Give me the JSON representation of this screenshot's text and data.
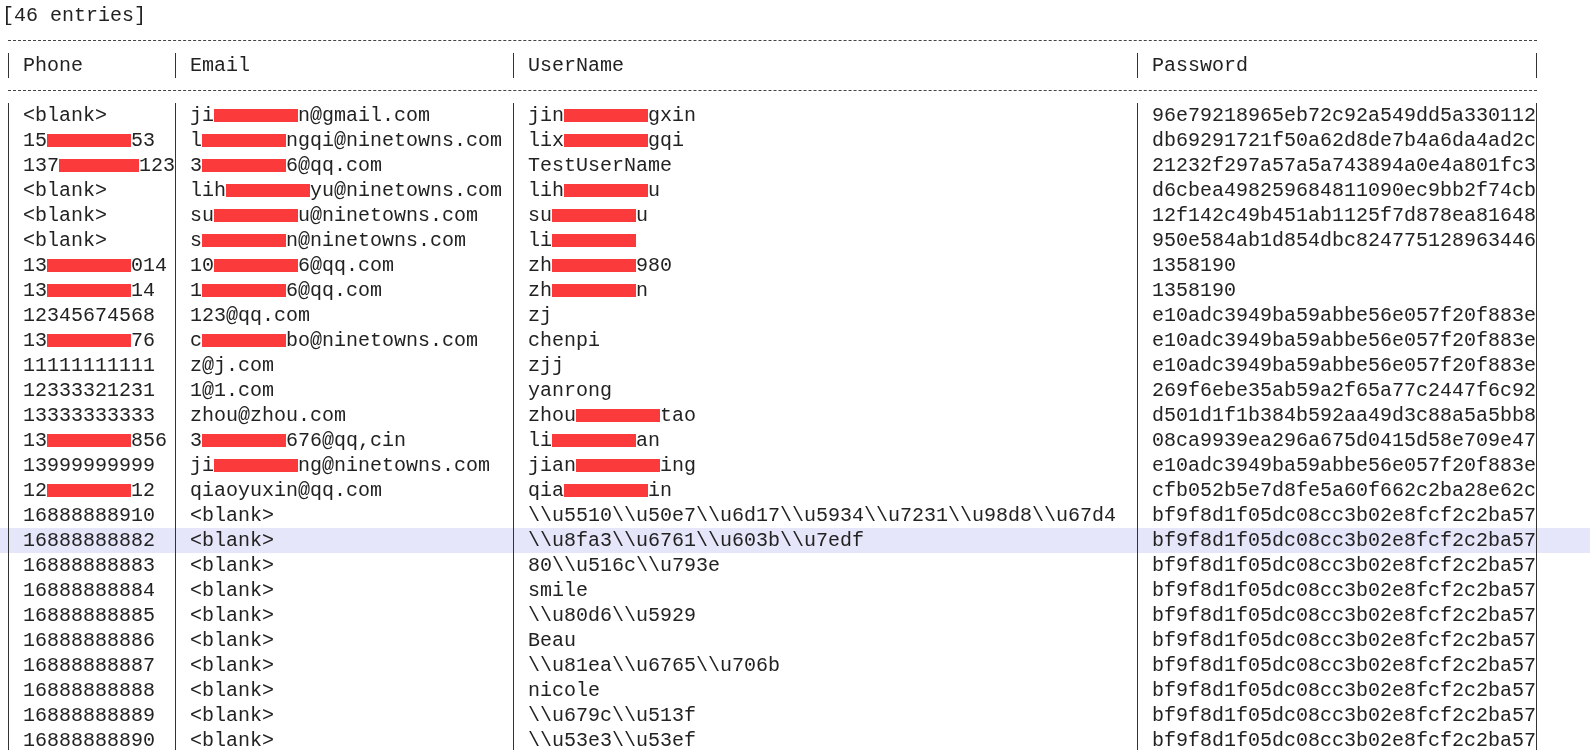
{
  "summary": "[46 entries]",
  "table": {
    "columns": [
      "Phone",
      "Email",
      "UserName",
      "Password"
    ],
    "rows": [
      {
        "highlighted": false,
        "cells": [
          "<blank>",
          [
            "ji",
            {
              "kind": "redaction"
            },
            "n@gmail.com"
          ],
          [
            "jin",
            {
              "kind": "redaction"
            },
            "gxin"
          ],
          "96e79218965eb72c92a549dd5a330112"
        ]
      },
      {
        "highlighted": false,
        "cells": [
          [
            "15",
            {
              "kind": "redaction"
            },
            "53"
          ],
          [
            "l",
            {
              "kind": "redaction"
            },
            "ngqi@ninetowns.com"
          ],
          [
            "lix",
            {
              "kind": "redaction"
            },
            "gqi"
          ],
          "db69291721f50a62d8de7b4a6da4ad2c"
        ]
      },
      {
        "highlighted": false,
        "cells": [
          [
            "137",
            {
              "kind": "redaction"
            },
            "123"
          ],
          [
            "3",
            {
              "kind": "redaction"
            },
            "6@qq.com"
          ],
          "TestUserName",
          "21232f297a57a5a743894a0e4a801fc3"
        ]
      },
      {
        "highlighted": false,
        "cells": [
          "<blank>",
          [
            "lih",
            {
              "kind": "redaction"
            },
            "yu@ninetowns.com"
          ],
          [
            "lih",
            {
              "kind": "redaction"
            },
            "u"
          ],
          "d6cbea498259684811090ec9bb2f74cb"
        ]
      },
      {
        "highlighted": false,
        "cells": [
          "<blank>",
          [
            "su",
            {
              "kind": "redaction"
            },
            "u@ninetowns.com"
          ],
          [
            "su",
            {
              "kind": "redaction"
            },
            "u"
          ],
          "12f142c49b451ab1125f7d878ea81648"
        ]
      },
      {
        "highlighted": false,
        "cells": [
          "<blank>",
          [
            "s",
            {
              "kind": "redaction"
            },
            "n@ninetowns.com"
          ],
          [
            "li",
            {
              "kind": "redaction"
            }
          ],
          "950e584ab1d854dbc824775128963446"
        ]
      },
      {
        "highlighted": false,
        "cells": [
          [
            "13",
            {
              "kind": "redaction"
            },
            "014"
          ],
          [
            "10",
            {
              "kind": "redaction"
            },
            "6@qq.com"
          ],
          [
            "zh",
            {
              "kind": "redaction"
            },
            "980"
          ],
          "1358190"
        ]
      },
      {
        "highlighted": false,
        "cells": [
          [
            "13",
            {
              "kind": "redaction"
            },
            "14"
          ],
          [
            "1",
            {
              "kind": "redaction"
            },
            "6@qq.com"
          ],
          [
            "zh",
            {
              "kind": "redaction"
            },
            "n"
          ],
          "1358190"
        ]
      },
      {
        "highlighted": false,
        "cells": [
          "12345674568",
          "123@qq.com",
          "zj",
          "e10adc3949ba59abbe56e057f20f883e"
        ]
      },
      {
        "highlighted": false,
        "cells": [
          [
            "13",
            {
              "kind": "redaction"
            },
            "76"
          ],
          [
            "c",
            {
              "kind": "redaction"
            },
            "bo@ninetowns.com"
          ],
          "chenpi",
          "e10adc3949ba59abbe56e057f20f883e"
        ]
      },
      {
        "highlighted": false,
        "cells": [
          "11111111111",
          "z@j.com",
          "zjj",
          "e10adc3949ba59abbe56e057f20f883e"
        ]
      },
      {
        "highlighted": false,
        "cells": [
          "12333321231",
          "1@1.com",
          "yanrong",
          "269f6ebe35ab59a2f65a77c2447f6c92"
        ]
      },
      {
        "highlighted": false,
        "cells": [
          "13333333333",
          "zhou@zhou.com",
          [
            "zhou",
            {
              "kind": "redaction"
            },
            "tao"
          ],
          "d501d1f1b384b592aa49d3c88a5a5bb8"
        ]
      },
      {
        "highlighted": false,
        "cells": [
          [
            "13",
            {
              "kind": "redaction"
            },
            "856"
          ],
          [
            "3",
            {
              "kind": "redaction"
            },
            "676@qq,cin"
          ],
          [
            "li",
            {
              "kind": "redaction"
            },
            "an"
          ],
          "08ca9939ea296a675d0415d58e709e47"
        ]
      },
      {
        "highlighted": false,
        "cells": [
          "13999999999",
          [
            "ji",
            {
              "kind": "redaction"
            },
            "ng@ninetowns.com"
          ],
          [
            "jian",
            {
              "kind": "redaction"
            },
            "ing"
          ],
          "e10adc3949ba59abbe56e057f20f883e"
        ]
      },
      {
        "highlighted": false,
        "cells": [
          [
            "12",
            {
              "kind": "redaction"
            },
            "12"
          ],
          "qiaoyuxin@qq.com",
          [
            "qia",
            {
              "kind": "redaction"
            },
            "in"
          ],
          "cfb052b5e7d8fe5a60f662c2ba28e62c"
        ]
      },
      {
        "highlighted": false,
        "cells": [
          "16888888910",
          "<blank>",
          "\\\\u5510\\\\u50e7\\\\u6d17\\\\u5934\\\\u7231\\\\u98d8\\\\u67d4",
          "bf9f8d1f05dc08cc3b02e8fcf2c2ba57"
        ]
      },
      {
        "highlighted": true,
        "cells": [
          "16888888882",
          "<blank>",
          "\\\\u8fa3\\\\u6761\\\\u603b\\\\u7edf",
          "bf9f8d1f05dc08cc3b02e8fcf2c2ba57"
        ]
      },
      {
        "highlighted": false,
        "cells": [
          "16888888883",
          "<blank>",
          "80\\\\u516c\\\\u793e",
          "bf9f8d1f05dc08cc3b02e8fcf2c2ba57"
        ]
      },
      {
        "highlighted": false,
        "cells": [
          "16888888884",
          "<blank>",
          "smile",
          "bf9f8d1f05dc08cc3b02e8fcf2c2ba57"
        ]
      },
      {
        "highlighted": false,
        "cells": [
          "16888888885",
          "<blank>",
          "\\\\u80d6\\\\u5929",
          "bf9f8d1f05dc08cc3b02e8fcf2c2ba57"
        ]
      },
      {
        "highlighted": false,
        "cells": [
          "16888888886",
          "<blank>",
          "Beau",
          "bf9f8d1f05dc08cc3b02e8fcf2c2ba57"
        ]
      },
      {
        "highlighted": false,
        "cells": [
          "16888888887",
          "<blank>",
          "\\\\u81ea\\\\u6765\\\\u706b",
          "bf9f8d1f05dc08cc3b02e8fcf2c2ba57"
        ]
      },
      {
        "highlighted": false,
        "cells": [
          "16888888888",
          "<blank>",
          "nicole",
          "bf9f8d1f05dc08cc3b02e8fcf2c2ba57"
        ]
      },
      {
        "highlighted": false,
        "cells": [
          "16888888889",
          "<blank>",
          "\\\\u679c\\\\u513f",
          "bf9f8d1f05dc08cc3b02e8fcf2c2ba57"
        ]
      },
      {
        "highlighted": false,
        "cells": [
          "16888888890",
          "<blank>",
          "\\\\u53e3\\\\u53ef",
          "bf9f8d1f05dc08cc3b02e8fcf2c2ba57"
        ]
      }
    ]
  }
}
